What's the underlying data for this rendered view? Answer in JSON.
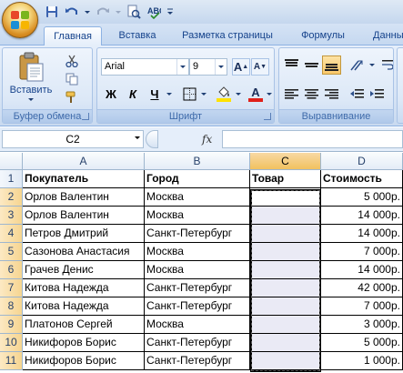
{
  "ribbon_tabs": [
    "Главная",
    "Вставка",
    "Разметка страницы",
    "Формулы",
    "Данны"
  ],
  "clipboard": {
    "paste_label": "Вставить",
    "group_label": "Буфер обмена"
  },
  "font": {
    "name": "Arial",
    "size": "9",
    "bold": "Ж",
    "italic": "К",
    "underline": "Ч",
    "grow": "A",
    "shrink": "A",
    "color_letter": "A",
    "group_label": "Шрифт"
  },
  "alignment": {
    "group_label": "Выравнивание"
  },
  "formula_bar": {
    "name_box": "C2",
    "fx": "fx",
    "formula": ""
  },
  "colors": {
    "font_color": "#e0201a",
    "fill_color": "#ffe200",
    "selection_header": "#f1c15f"
  },
  "grid": {
    "columns": [
      "A",
      "B",
      "C",
      "D"
    ],
    "rows": [
      "1",
      "2",
      "3",
      "4",
      "5",
      "6",
      "7",
      "8",
      "9",
      "10",
      "11"
    ],
    "header": [
      "Покупатель",
      "Город",
      "Товар",
      "Стоимость"
    ],
    "data": [
      [
        "Орлов Валентин",
        "Москва",
        "",
        "5 000р."
      ],
      [
        "Орлов Валентин",
        "Москва",
        "",
        "14 000р."
      ],
      [
        "Петров Дмитрий",
        "Санкт-Петербург",
        "",
        "14 000р."
      ],
      [
        "Сазонова Анастасия",
        "Москва",
        "",
        "7 000р."
      ],
      [
        "Грачев Денис",
        "Москва",
        "",
        "14 000р."
      ],
      [
        "Китова Надежда",
        "Санкт-Петербург",
        "",
        "42 000р."
      ],
      [
        "Китова Надежда",
        "Санкт-Петербург",
        "",
        "7 000р."
      ],
      [
        "Платонов Сергей",
        "Москва",
        "",
        "3 000р."
      ],
      [
        "Никифоров Борис",
        "Санкт-Петербург",
        "",
        "5 000р."
      ],
      [
        "Никифоров Борис",
        "Санкт-Петербург",
        "",
        "1 000р."
      ]
    ]
  }
}
